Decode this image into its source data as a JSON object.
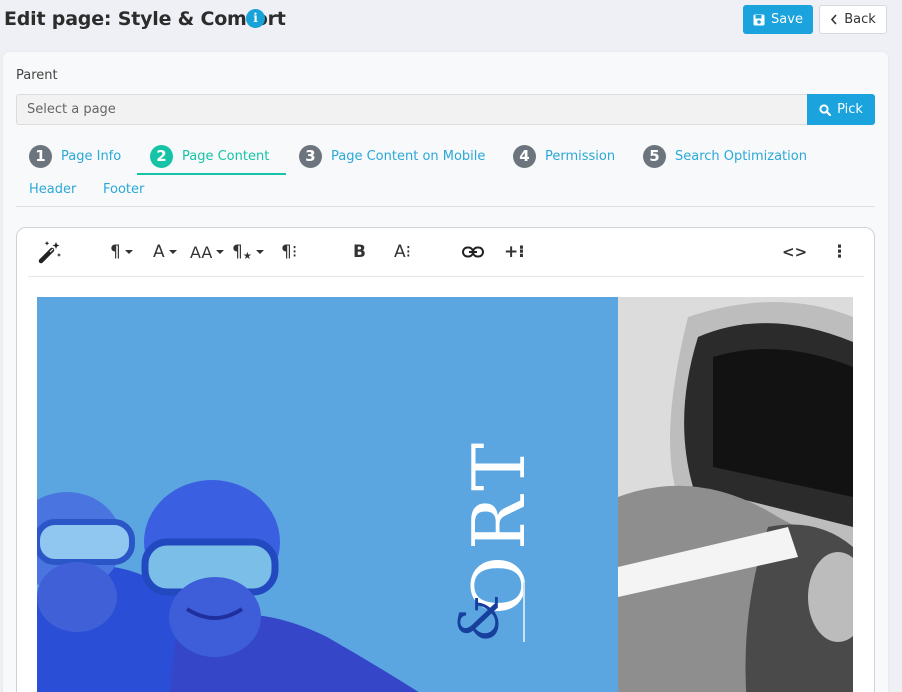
{
  "header": {
    "title": "Edit page: Style & Comfort",
    "save_label": "Save",
    "back_label": "Back"
  },
  "parent": {
    "label": "Parent",
    "placeholder": "Select a page",
    "pick_label": "Pick"
  },
  "tabs": [
    {
      "number": "1",
      "label": "Page Info"
    },
    {
      "number": "2",
      "label": "Page Content"
    },
    {
      "number": "3",
      "label": "Page Content on Mobile"
    },
    {
      "number": "4",
      "label": "Permission"
    },
    {
      "number": "5",
      "label": "Search Optimization"
    }
  ],
  "active_tab": "Page Content",
  "subtabs": [
    "Header",
    "Footer"
  ],
  "toolbar": {
    "magic_icon": "magic-wand-icon",
    "paragraph": "¶",
    "font": "A",
    "font_size": "AA",
    "paragraph_style": "¶",
    "paragraph_more": "¶⁝",
    "bold": "B",
    "text_more": "A⁝",
    "link_icon": "link-icon",
    "insert_more": "+⁝",
    "code_view": "<>",
    "more_menu": "⋮"
  },
  "hero": {
    "vertical_text": "ORT",
    "ampersand": "&"
  },
  "colors": {
    "accent": "#1aa3dd",
    "active": "#16c3a6",
    "hero_blue": "#5ba6e0"
  }
}
